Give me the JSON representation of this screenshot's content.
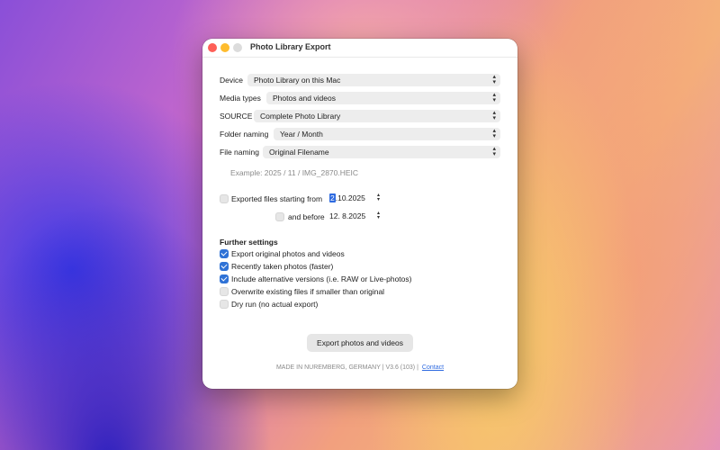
{
  "window": {
    "title": "Photo Library Export"
  },
  "form": {
    "device": {
      "label": "Device",
      "value": "Photo Library on this Mac"
    },
    "media_types": {
      "label": "Media types",
      "value": "Photos and videos"
    },
    "source": {
      "label": "SOURCE",
      "value": "Complete Photo Library"
    },
    "folder_naming": {
      "label": "Folder naming",
      "value": "Year / Month"
    },
    "file_naming": {
      "label": "File naming",
      "value": "Original Filename"
    },
    "example": "Example: 2025 / 11 / IMG_2870.HEIC"
  },
  "date_filter": {
    "from_label": "Exported files starting from",
    "from_day": "2",
    "from_rest": ".10.2025",
    "before_label": "and before",
    "before_date": "12.  8.2025",
    "from_checked": false,
    "before_checked": false
  },
  "further": {
    "title": "Further settings",
    "options": [
      {
        "label": "Export original photos and videos",
        "checked": true
      },
      {
        "label": "Recently taken photos (faster)",
        "checked": true
      },
      {
        "label": "Include alternative versions (i.e. RAW or Live-photos)",
        "checked": true
      },
      {
        "label": "Overwrite existing files if smaller than original",
        "checked": false
      },
      {
        "label": "Dry run (no actual export)",
        "checked": false
      }
    ]
  },
  "export_button": "Export photos and videos",
  "footer": {
    "text": "MADE IN NUREMBERG, GERMANY | V3.6 (103) |",
    "link": "Contact"
  },
  "icons": {
    "popup": "chevron-updown-icon",
    "stepper": "stepper-icon",
    "check": "checkmark-icon"
  },
  "colors": {
    "accent": "#2f72d6",
    "close": "#fe5f57",
    "minimize": "#febc2e"
  }
}
